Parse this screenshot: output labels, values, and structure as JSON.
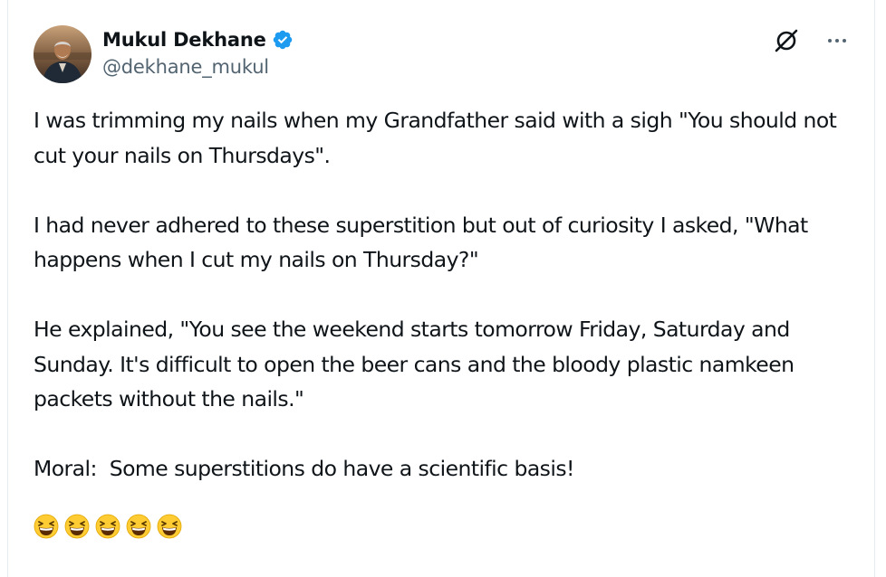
{
  "author": {
    "display_name": "Mukul Dekhane",
    "handle": "@dekhane_mukul",
    "verified": true,
    "avatar_icon": "profile-photo",
    "verified_color": "#1d9bf0"
  },
  "toolbar": {
    "grok_icon": "grok-icon",
    "more_icon": "more-options-icon"
  },
  "tweet": {
    "line1": "I was trimming my nails when my Grandfather said with a sigh \"You should not cut your nails on Thursdays\".",
    "line2": "I had never adhered to these superstition but out of curiosity I asked, \"What happens when I cut my nails on Thursday?\"",
    "line3": "He explained, \"You see the weekend starts tomorrow Friday, Saturday and Sunday. It's difficult to open the beer cans and the bloody plastic namkeen packets without the nails.\"",
    "line4": "Moral:  Some superstitions do have a scientific basis!",
    "emojis": [
      "grinning-squinting-face",
      "grinning-squinting-face",
      "grinning-squinting-face",
      "grinning-squinting-face",
      "grinning-squinting-face"
    ]
  },
  "colors": {
    "text": "#0f1419",
    "secondary": "#536471",
    "emoji_face": "#ffcc33"
  }
}
